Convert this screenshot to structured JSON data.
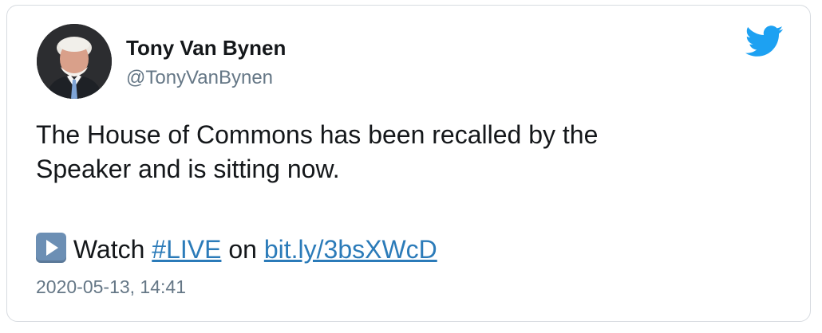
{
  "tweet": {
    "author_name": "Tony Van Bynen",
    "author_handle": "@TonyVanBynen",
    "text_line1": "The House of Commons has been recalled by the",
    "text_line2": "Speaker and is sitting now.",
    "watch_label": "Watch",
    "hashtag": "#LIVE",
    "on_label": "on",
    "link": "bit.ly/3bsXWcD",
    "timestamp": "2020-05-13, 14:41"
  },
  "icons": {
    "logo": "twitter-bird-icon",
    "play": "play-button-icon"
  },
  "colors": {
    "twitter_blue": "#1da1f2",
    "link": "#2b7bb9",
    "secondary_text": "#657786",
    "primary_text": "#14171a",
    "border": "#d7dbe0"
  }
}
